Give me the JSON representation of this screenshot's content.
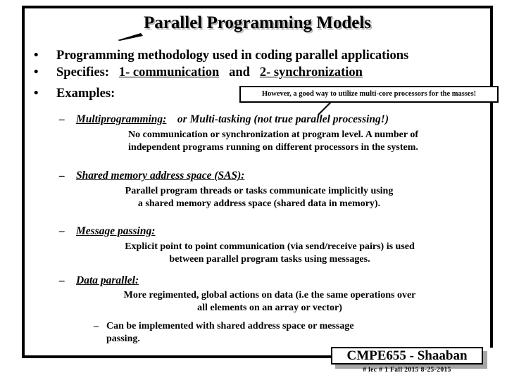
{
  "slide": {
    "title": "Parallel Programming Models",
    "bullets": [
      {
        "text_before": "Programming methodology used in coding parallel applications",
        "marker": "•"
      },
      {
        "label": "Specifies:",
        "item1": "1- communication",
        "conj": "and",
        "item2": "2- synchronization",
        "marker": "•"
      },
      {
        "text_before": "Examples:",
        "marker": "•"
      }
    ],
    "callout": {
      "text": "However, a good way to utilize multi-core processors for the masses!"
    },
    "sections": [
      {
        "dash": "–",
        "heading": "Multiprogramming:",
        "heading_tail": "or Multi-tasking (not true parallel processing!)",
        "body": [
          "No communication or synchronization at program level.  A number of",
          "independent programs running on different processors in the system."
        ]
      },
      {
        "dash": "–",
        "heading": "Shared memory address space (SAS):",
        "heading_tail": "",
        "body": [
          "Parallel program threads or tasks communicate implicitly using",
          "a shared memory address space (shared data in memory)."
        ]
      },
      {
        "dash": "–",
        "heading": "Message passing:",
        "heading_tail": "",
        "body": [
          "Explicit point to point communication (via send/receive pairs) is used",
          "between parallel program tasks using messages."
        ]
      },
      {
        "dash": "–",
        "heading": "Data parallel:",
        "heading_tail": "",
        "body": [
          "More regimented, global actions on data (i.e the same operations over",
          "all elements on an array or vector)"
        ],
        "subitem": {
          "dash": "–",
          "line1": "Can be implemented with shared address space or message",
          "line2": "passing."
        }
      }
    ],
    "footer": {
      "course": "CMPE655 - Shaaban",
      "meta": "#  lec # 1   Fall 2015   8-25-2015"
    },
    "colors": {
      "text": "#000000",
      "background": "#ffffff",
      "shadow": "#a6a6a6",
      "title_shadow": "#b9b9b9"
    }
  }
}
